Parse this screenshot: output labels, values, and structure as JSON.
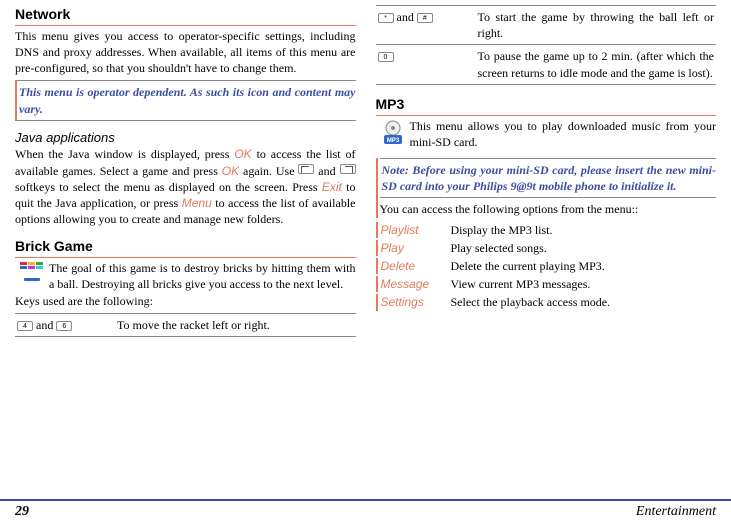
{
  "col1": {
    "network": {
      "title": "Network",
      "body": "This menu gives you access to operator-specific settings, including DNS and proxy addresses. When available, all items of this menu are pre-configured, so that you shouldn't have to change them.",
      "note": "This menu is operator dependent. As such its icon and content may vary."
    },
    "java": {
      "title": "Java applications",
      "body0": "When the Java window is displayed, press ",
      "ok1": "OK",
      "body1": " to access the list of available games. Select a game and press ",
      "ok2": "OK",
      "body2": " again. Use ",
      "and": " and ",
      "body3": " softkeys to select the menu as displayed on the screen. Press ",
      "exit": "Exit",
      "body4": " to quit the Java application, or press ",
      "menu": "Menu",
      "body5": " to access the list of available options allowing you to create and manage new folders."
    },
    "brick": {
      "title": "Brick Game",
      "body": "The goal of this game is to destroy bricks by hitting them with a ball. Destroying all bricks give you access to the next level.",
      "keysintro": "Keys used are the following:",
      "row1_k1": "4",
      "row1_and": " and ",
      "row1_k2": "6",
      "row1_desc": "To move the racket left or right."
    }
  },
  "col2": {
    "brick_cont": {
      "row2_k1": "*",
      "row2_and": " and ",
      "row2_k2": "#",
      "row2_desc": "To start the game by throwing the ball left or right.",
      "row3_k1": "0",
      "row3_desc": "To pause the game up to 2 min. (after which the screen returns to idle mode and the game is lost)."
    },
    "mp3": {
      "title": "MP3",
      "body": "This menu allows you to play downloaded music from your mini-SD card.",
      "note": "Note: Before using your mini-SD card, please insert the new mini-SD card into your Philips 9@9t mobile phone to initialize it.",
      "intro": "You can access the following options from the menu::",
      "opts": {
        "playlist": {
          "label": "Playlist",
          "desc": "Display the MP3 list."
        },
        "play": {
          "label": "Play",
          "desc": "Play selected songs."
        },
        "delete": {
          "label": "Delete",
          "desc": "Delete the current playing MP3."
        },
        "message": {
          "label": "Message",
          "desc": "View current MP3 messages."
        },
        "settings": {
          "label": "Settings",
          "desc": "Select the playback access mode."
        }
      }
    }
  },
  "footer": {
    "page": "29",
    "section": "Entertainment"
  }
}
